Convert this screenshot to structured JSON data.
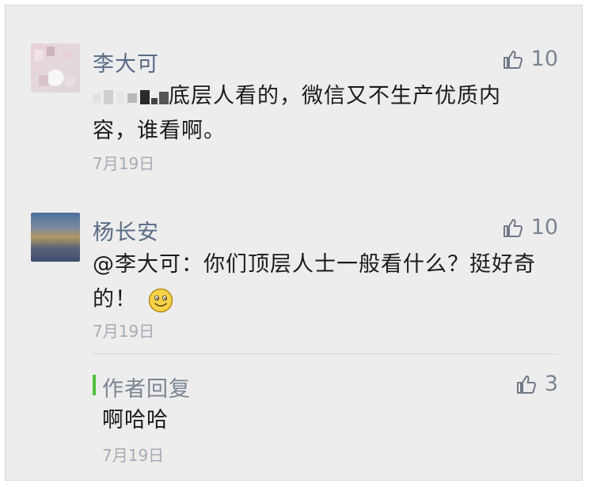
{
  "comments": [
    {
      "name": "李大可",
      "likes": "10",
      "text_part": "底层人看的，微信又不生产优质内",
      "text_line2": "容，谁看啊。",
      "date": "7月19日"
    },
    {
      "name": "杨长安",
      "likes": "10",
      "text_line1": "@李大可：你们顶层人士一般看什么？挺好奇",
      "text_line2": "的！",
      "date": "7月19日"
    }
  ],
  "reply": {
    "title": "作者回复",
    "likes": "3",
    "text": "啊哈哈",
    "date": "7月19日"
  },
  "icons": {
    "like": "thumbs-up-icon",
    "emoji": "smiley-face-icon"
  },
  "colors": {
    "background": "#ededed",
    "name": "#586b85",
    "text": "#1b1b1b",
    "date": "#a7acb3",
    "reply_accent": "#4fc13c"
  }
}
